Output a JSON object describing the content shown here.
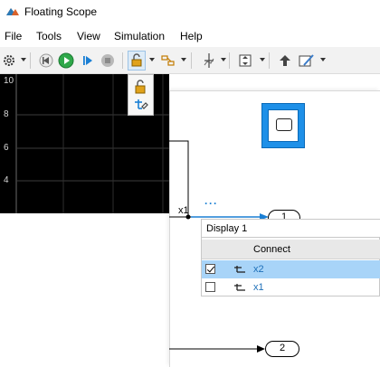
{
  "window": {
    "title": "Floating Scope"
  },
  "menubar": {
    "items": [
      "File",
      "Tools",
      "View",
      "Simulation",
      "Help"
    ]
  },
  "plot": {
    "y_ticks": [
      "10",
      "8",
      "6",
      "4"
    ]
  },
  "model": {
    "signal_label": "x1",
    "ellipsis": "···",
    "outports": [
      "1",
      "2"
    ]
  },
  "selector": {
    "display_value": "Display 1",
    "column_header": "Connect",
    "rows": [
      {
        "label": "x2",
        "checked": true,
        "selected": true
      },
      {
        "label": "x1",
        "checked": false,
        "selected": false
      }
    ]
  },
  "colors": {
    "scope_block": "#1e90e8",
    "selection": "#a8d4f8",
    "signal_text": "#1d6fb8",
    "plot_background": "#000000"
  },
  "icons": {
    "app": "matlab-scope-icon",
    "toolbar": [
      "settings-icon",
      "step-back-icon",
      "run-icon",
      "step-forward-icon",
      "stop-icon",
      "signal-selector-lock-icon",
      "triggers-icon",
      "cursor-measurements-icon",
      "autoscale-icon",
      "highlight-block-icon",
      "style-icon"
    ],
    "dropdown": [
      "lock-icon",
      "connect-signal-icon"
    ]
  }
}
